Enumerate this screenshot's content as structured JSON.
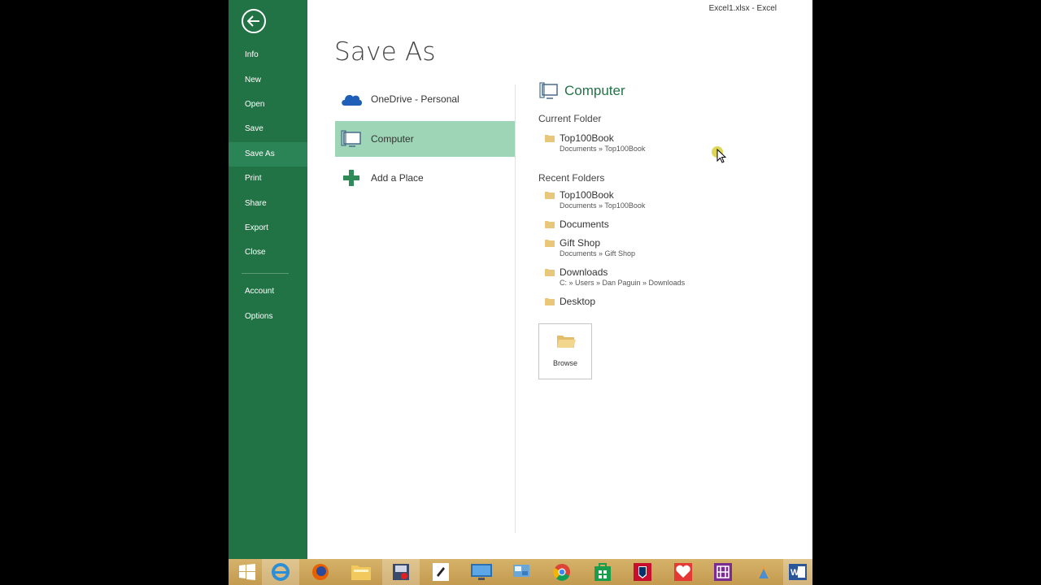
{
  "window": {
    "title": "Excel1.xlsx - Excel"
  },
  "page": {
    "title": "Save As"
  },
  "sidebar": {
    "items": [
      {
        "label": "Info"
      },
      {
        "label": "New"
      },
      {
        "label": "Open"
      },
      {
        "label": "Save"
      },
      {
        "label": "Save As"
      },
      {
        "label": "Print"
      },
      {
        "label": "Share"
      },
      {
        "label": "Export"
      },
      {
        "label": "Close"
      },
      {
        "label": "Account"
      },
      {
        "label": "Options"
      }
    ],
    "active": "Save As"
  },
  "places": [
    {
      "label": "OneDrive - Personal",
      "icon": "cloud-icon"
    },
    {
      "label": "Computer",
      "icon": "computer-icon",
      "selected": true
    },
    {
      "label": "Add a Place",
      "icon": "plus-icon"
    }
  ],
  "pane": {
    "title": "Computer",
    "current_folder_heading": "Current Folder",
    "current_folder": {
      "name": "Top100Book",
      "path": "Documents » Top100Book"
    },
    "recent_heading": "Recent Folders",
    "recent": [
      {
        "name": "Top100Book",
        "path": "Documents » Top100Book"
      },
      {
        "name": "Documents",
        "path": ""
      },
      {
        "name": "Gift Shop",
        "path": "Documents » Gift Shop"
      },
      {
        "name": "Downloads",
        "path": "C: » Users » Dan Paguin » Downloads"
      },
      {
        "name": "Desktop",
        "path": ""
      }
    ],
    "browse_label": "Browse"
  },
  "taskbar": {
    "icons": [
      "windows-start-icon",
      "internet-explorer-icon",
      "firefox-icon",
      "file-explorer-icon",
      "recorder-icon",
      "pen-app-icon",
      "lenovo-monitor-icon",
      "control-panel-icon",
      "chrome-icon",
      "store-icon",
      "nfl-app-icon",
      "health-app-icon",
      "onenote-icon",
      "lab-app-icon",
      "word-icon"
    ]
  },
  "colors": {
    "accent": "#217346",
    "selected": "#9fd5b7"
  }
}
